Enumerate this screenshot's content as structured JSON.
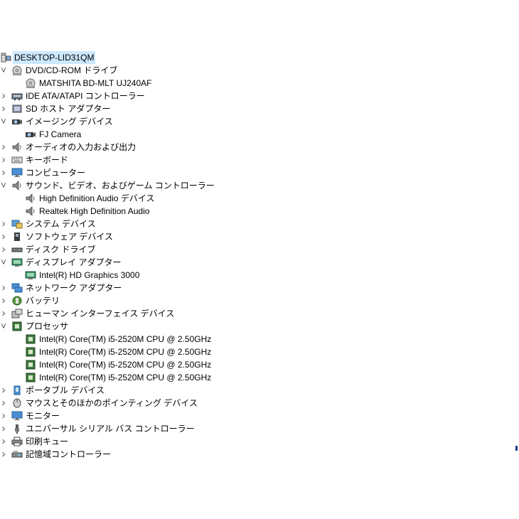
{
  "tree": [
    {
      "label": "DESKTOP-LID31QM",
      "level": 0,
      "state": "none",
      "icon": "computer",
      "root": true
    },
    {
      "label": "DVD/CD-ROM ドライブ",
      "level": 1,
      "state": "expanded",
      "icon": "disc"
    },
    {
      "label": "MATSHITA BD-MLT UJ240AF",
      "level": 2,
      "state": "none",
      "icon": "disc"
    },
    {
      "label": "IDE ATA/ATAPI コントローラー",
      "level": 1,
      "state": "collapsed",
      "icon": "ide"
    },
    {
      "label": "SD ホスト アダプター",
      "level": 1,
      "state": "collapsed",
      "icon": "sd"
    },
    {
      "label": "イメージング デバイス",
      "level": 1,
      "state": "expanded",
      "icon": "camera"
    },
    {
      "label": "FJ Camera",
      "level": 2,
      "state": "none",
      "icon": "camera"
    },
    {
      "label": "オーディオの入力および出力",
      "level": 1,
      "state": "collapsed",
      "icon": "speaker"
    },
    {
      "label": "キーボード",
      "level": 1,
      "state": "collapsed",
      "icon": "keyboard"
    },
    {
      "label": "コンピューター",
      "level": 1,
      "state": "collapsed",
      "icon": "monitor"
    },
    {
      "label": "サウンド、ビデオ、およびゲーム コントローラー",
      "level": 1,
      "state": "expanded",
      "icon": "speaker"
    },
    {
      "label": "High Definition Audio デバイス",
      "level": 2,
      "state": "none",
      "icon": "speaker"
    },
    {
      "label": "Realtek High Definition Audio",
      "level": 2,
      "state": "none",
      "icon": "speaker"
    },
    {
      "label": "システム デバイス",
      "level": 1,
      "state": "collapsed",
      "icon": "system"
    },
    {
      "label": "ソフトウェア デバイス",
      "level": 1,
      "state": "collapsed",
      "icon": "software"
    },
    {
      "label": "ディスク ドライブ",
      "level": 1,
      "state": "collapsed",
      "icon": "disk"
    },
    {
      "label": "ディスプレイ アダプター",
      "level": 1,
      "state": "expanded",
      "icon": "display"
    },
    {
      "label": "Intel(R) HD Graphics 3000",
      "level": 2,
      "state": "none",
      "icon": "display"
    },
    {
      "label": "ネットワーク アダプター",
      "level": 1,
      "state": "collapsed",
      "icon": "network"
    },
    {
      "label": "バッテリ",
      "level": 1,
      "state": "collapsed",
      "icon": "battery"
    },
    {
      "label": "ヒューマン インターフェイス デバイス",
      "level": 1,
      "state": "collapsed",
      "icon": "hid"
    },
    {
      "label": "プロセッサ",
      "level": 1,
      "state": "expanded",
      "icon": "cpu"
    },
    {
      "label": "Intel(R) Core(TM) i5-2520M CPU @ 2.50GHz",
      "level": 2,
      "state": "none",
      "icon": "cpu"
    },
    {
      "label": "Intel(R) Core(TM) i5-2520M CPU @ 2.50GHz",
      "level": 2,
      "state": "none",
      "icon": "cpu"
    },
    {
      "label": "Intel(R) Core(TM) i5-2520M CPU @ 2.50GHz",
      "level": 2,
      "state": "none",
      "icon": "cpu"
    },
    {
      "label": "Intel(R) Core(TM) i5-2520M CPU @ 2.50GHz",
      "level": 2,
      "state": "none",
      "icon": "cpu"
    },
    {
      "label": "ポータブル デバイス",
      "level": 1,
      "state": "collapsed",
      "icon": "portable"
    },
    {
      "label": "マウスとそのほかのポインティング デバイス",
      "level": 1,
      "state": "collapsed",
      "icon": "mouse"
    },
    {
      "label": "モニター",
      "level": 1,
      "state": "collapsed",
      "icon": "monitor"
    },
    {
      "label": "ユニバーサル シリアル バス コントローラー",
      "level": 1,
      "state": "collapsed",
      "icon": "usb"
    },
    {
      "label": "印刷キュー",
      "level": 1,
      "state": "collapsed",
      "icon": "printer"
    },
    {
      "label": "記憶域コントローラー",
      "level": 1,
      "state": "collapsed",
      "icon": "storage"
    }
  ]
}
